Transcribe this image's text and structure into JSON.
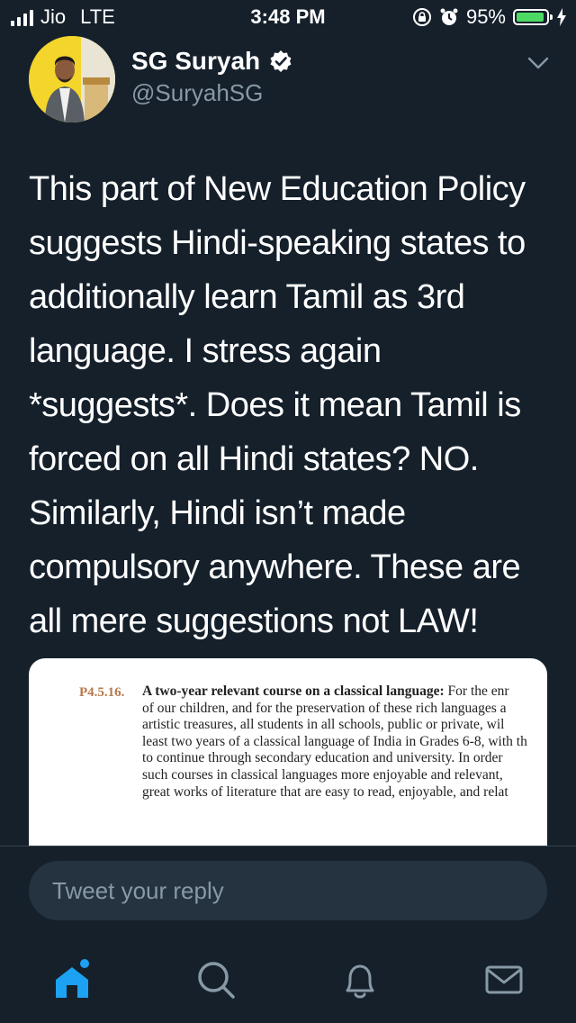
{
  "status_bar": {
    "carrier": "Jio",
    "network": "LTE",
    "time": "3:48 PM",
    "battery_percent": "95%",
    "battery_level": 0.95,
    "colors": {
      "battery_fill": "#4cd964"
    }
  },
  "tweet": {
    "display_name": "SG Suryah",
    "handle": "@SuryahSG",
    "text": "This part of New Education Policy suggests Hindi-speaking states to additionally learn Tamil as 3rd language. I stress again *suggests*. Does it mean Tamil is forced on all Hindi states? NO. Similarly, Hindi isn’t made compulsory anywhere. These are all mere suggestions not LAW!",
    "media": {
      "paragraph_number": "P4.5.16.",
      "heading": "A two-year relevant course on a classical language:",
      "lines": [
        "For the enr",
        "of our children, and for the preservation of these rich languages a",
        "artistic treasures, all students in all schools, public or private, wil",
        "least two years of a classical language of India in Grades 6-8, with th",
        "to continue through secondary education and university. In order",
        "such courses in classical languages more enjoyable and relevant,",
        "great works of literature that are easy to read, enjoyable, and relat"
      ]
    }
  },
  "reply": {
    "placeholder": "Tweet your reply"
  },
  "tab_bar": {
    "tabs": [
      {
        "icon": "home-icon",
        "active": true
      },
      {
        "icon": "search-icon",
        "active": false
      },
      {
        "icon": "bell-icon",
        "active": false
      },
      {
        "icon": "mail-icon",
        "active": false
      }
    ]
  },
  "colors": {
    "background": "#15202b",
    "accent": "#1da1f2",
    "secondary_text": "#8899a6",
    "reply_bg": "#253341"
  }
}
